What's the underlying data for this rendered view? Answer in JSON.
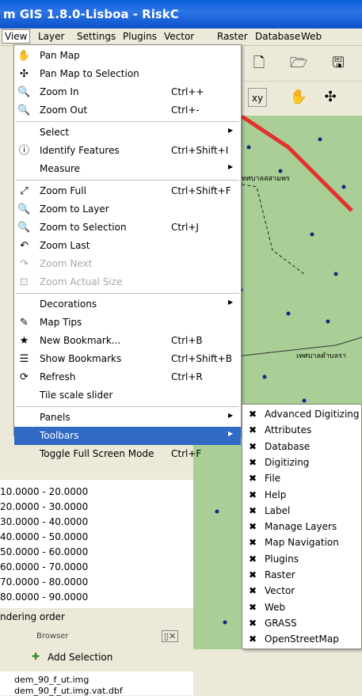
{
  "window": {
    "title": "m GIS 1.8.0-Lisboa - RiskC"
  },
  "menubar": [
    {
      "label": "View",
      "active": true
    },
    {
      "label": "Layer"
    },
    {
      "label": "Settings"
    },
    {
      "label": "Plugins"
    },
    {
      "label": "Vector"
    },
    {
      "label": "Raster"
    },
    {
      "label": "Database"
    },
    {
      "label": "Web"
    }
  ],
  "view_menu": [
    {
      "label": "Pan Map",
      "icon": "hand-icon",
      "shortcut": ""
    },
    {
      "label": "Pan Map to Selection",
      "icon": "pan-selection-icon",
      "shortcut": ""
    },
    {
      "label": "Zoom In",
      "icon": "zoom-in-icon",
      "shortcut": "Ctrl++"
    },
    {
      "label": "Zoom Out",
      "icon": "zoom-out-icon",
      "shortcut": "Ctrl+-"
    },
    {
      "sep": true
    },
    {
      "label": "Select",
      "submenu": true
    },
    {
      "label": "Identify Features",
      "icon": "identify-icon",
      "shortcut": "Ctrl+Shift+I"
    },
    {
      "label": "Measure",
      "submenu": true
    },
    {
      "sep": true
    },
    {
      "label": "Zoom Full",
      "icon": "zoom-full-icon",
      "shortcut": "Ctrl+Shift+F"
    },
    {
      "label": "Zoom to Layer",
      "icon": "zoom-layer-icon",
      "shortcut": ""
    },
    {
      "label": "Zoom to Selection",
      "icon": "zoom-selection-icon",
      "shortcut": "Ctrl+J"
    },
    {
      "label": "Zoom Last",
      "icon": "zoom-last-icon",
      "shortcut": ""
    },
    {
      "label": "Zoom Next",
      "icon": "zoom-next-icon",
      "disabled": true
    },
    {
      "label": "Zoom Actual Size",
      "icon": "zoom-actual-icon",
      "disabled": true
    },
    {
      "sep": true
    },
    {
      "label": "Decorations",
      "submenu": true
    },
    {
      "label": "Map Tips",
      "icon": "map-tips-icon",
      "shortcut": ""
    },
    {
      "label": "New Bookmark...",
      "icon": "new-bookmark-icon",
      "shortcut": "Ctrl+B"
    },
    {
      "label": "Show Bookmarks",
      "icon": "bookmarks-icon",
      "shortcut": "Ctrl+Shift+B"
    },
    {
      "label": "Refresh",
      "icon": "refresh-icon",
      "shortcut": "Ctrl+R"
    },
    {
      "label": "Tile scale slider",
      "shortcut": ""
    },
    {
      "sep": true
    },
    {
      "label": "Panels",
      "submenu": true
    },
    {
      "label": "Toolbars",
      "submenu": true,
      "highlighted": true
    },
    {
      "label": "Toggle Full Screen Mode",
      "shortcut": "Ctrl+F"
    }
  ],
  "toolbars_submenu": [
    "Advanced Digitizing",
    "Attributes",
    "Database",
    "Digitizing",
    "File",
    "Help",
    "Label",
    "Manage Layers",
    "Map Navigation",
    "Plugins",
    "Raster",
    "Vector",
    "Web",
    "GRASS",
    "OpenStreetMap"
  ],
  "legend": [
    "10.0000 - 20.0000",
    "20.0000 - 30.0000",
    "30.0000 - 40.0000",
    "40.0000 - 50.0000",
    "50.0000 - 60.0000",
    "60.0000 - 70.0000",
    "70.0000 - 80.0000",
    "80.0000 - 90.0000"
  ],
  "left_panel": {
    "rendering_order": "ndering order",
    "browser_title": "Browser",
    "add_selection": "Add Selection",
    "files": [
      "dem_90_f_ut.img",
      "dem_90_f_ut.img.vat.dbf"
    ]
  },
  "map": {
    "labels": [
      "เทศบาลสสามพร",
      "เทศบาลตำบลรา"
    ]
  }
}
